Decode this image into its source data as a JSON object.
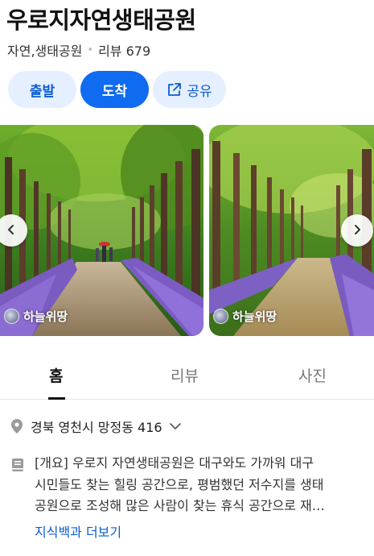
{
  "place": {
    "name": "우로지자연생태공원",
    "category": "자연,생태공원",
    "review_label": "리뷰 679"
  },
  "actions": {
    "depart": "출발",
    "arrive": "도착",
    "share": "공유"
  },
  "photos": [
    {
      "credit": "하늘위땅"
    },
    {
      "credit": "하늘위땅"
    }
  ],
  "tabs": [
    "홈",
    "리뷰",
    "사진"
  ],
  "address": "경북 영천시 망정동 416",
  "summary_lines": [
    "[개요] 우로지 자연생태공원은 대구와도 가까워 대구",
    "시민들도 찾는 힐링 공간으로, 평범했던 저수지를 생태",
    "공원으로 조성해 많은 사람이 찾는 휴식 공간으로 재…"
  ],
  "more_link": "지식백과 더보기",
  "colors": {
    "accent": "#0f6bf0",
    "accent_light": "#e5efff",
    "link": "#0b5cd5"
  },
  "icons": [
    "share-icon",
    "chevron-left-icon",
    "chevron-right-icon",
    "location-pin-icon",
    "chevron-down-icon",
    "book-icon"
  ]
}
